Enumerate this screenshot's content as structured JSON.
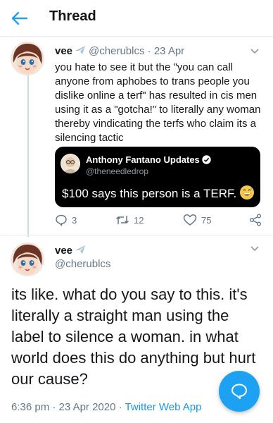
{
  "colors": {
    "accent": "#1da1f2",
    "link": "#1b95e0",
    "muted": "#657786",
    "quote_bg": "#000000"
  },
  "header": {
    "title": "Thread",
    "back_icon": "arrow-left-icon"
  },
  "tweet1": {
    "name": "vee",
    "name_icon": "airplane-emoji-icon",
    "handle": "@cherublcs",
    "separator": "·",
    "date": "23 Apr",
    "text": "you hate to see it but the \"you can call anyone from aphobes to trans people you dislike online a terf\" has resulted in cis men using it as a \"gotcha!\" to literally any woman thereby vindicating the terfs who claim its a silencing tactic",
    "quoted": {
      "name": "Anthony Fantano Updates",
      "verified_icon": "verified-badge-icon",
      "handle": "@theneedledrop",
      "text": "$100 says this person is a TERF.",
      "emoji_icon": "grinning-sweat-emoji-icon"
    },
    "actions": {
      "replies": "3",
      "retweets": "12",
      "likes": "75"
    }
  },
  "tweet2": {
    "name": "vee",
    "name_icon": "airplane-emoji-icon",
    "handle": "@cherublcs",
    "text": "its like. what do you say to this. it's literally a straight man using the label to silence a woman. in what world does this do anything but hurt our cause?",
    "time": "6:36 pm",
    "dot1": "·",
    "date": "23 Apr 2020",
    "dot2": "·",
    "app": "Twitter Web App"
  },
  "fab": {
    "icon": "compose-reply-icon"
  }
}
